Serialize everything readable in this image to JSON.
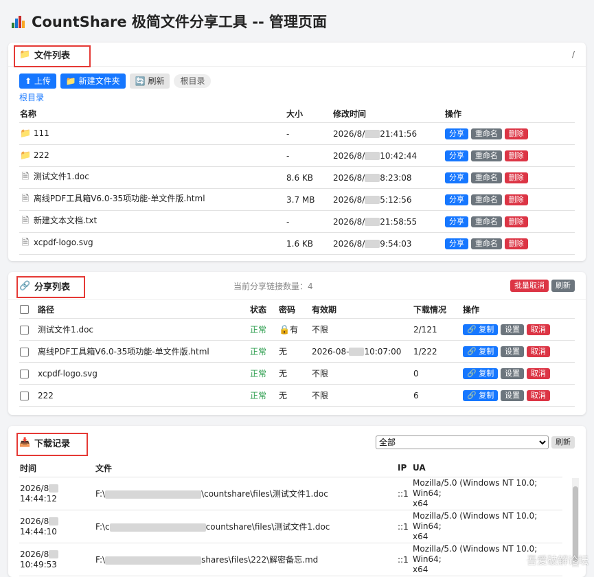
{
  "page": {
    "title": "CountShare 极简文件分享工具 -- 管理页面"
  },
  "files": {
    "title": "文件列表",
    "path_right": "/",
    "buttons": {
      "upload": "上传",
      "new_folder": "新建文件夹",
      "refresh": "刷新"
    },
    "current_dir": "根目录",
    "breadcrumb": "根目录",
    "headers": [
      "名称",
      "大小",
      "修改时间",
      "操作"
    ],
    "rows": [
      {
        "type": "folder",
        "name": "111",
        "size": "-",
        "time_a": "2026/8/",
        "time_b": "21:41:56"
      },
      {
        "type": "folder",
        "name": "222",
        "size": "-",
        "time_a": "2026/8/",
        "time_b": "10:42:44"
      },
      {
        "type": "file",
        "name": "测试文件1.doc",
        "size": "8.6 KB",
        "time_a": "2026/8/",
        "time_b": "8:23:08"
      },
      {
        "type": "file",
        "name": "离线PDF工具箱V6.0-35项功能-单文件版.html",
        "size": "3.7 MB",
        "time_a": "2026/8/",
        "time_b": "5:12:56"
      },
      {
        "type": "file",
        "name": "新建文本文档.txt",
        "size": "-",
        "time_a": "2026/8/",
        "time_b": "21:58:55"
      },
      {
        "type": "file",
        "name": "xcpdf-logo.svg",
        "size": "1.6 KB",
        "time_a": "2026/8/",
        "time_b": "9:54:03"
      }
    ],
    "actions": {
      "share": "分享",
      "rename": "重命名",
      "delete": "删除"
    }
  },
  "shares": {
    "title": "分享列表",
    "count_label": "当前分享链接数量：",
    "count": "4",
    "buttons": {
      "batch_cancel": "批量取消",
      "refresh": "刷新"
    },
    "headers": [
      "路径",
      "状态",
      "密码",
      "有效期",
      "下载情况",
      "操作"
    ],
    "rows": [
      {
        "path": "测试文件1.doc",
        "status": "正常",
        "password": "有",
        "locked": true,
        "expire": "不限",
        "downloads": "2/121"
      },
      {
        "path": "离线PDF工具箱V6.0-35项功能-单文件版.html",
        "status": "正常",
        "password": "无",
        "locked": false,
        "expire": "2026-08-",
        "expire_b": "10:07:00",
        "downloads": "1/222"
      },
      {
        "path": "xcpdf-logo.svg",
        "status": "正常",
        "password": "无",
        "locked": false,
        "expire": "不限",
        "downloads": "0"
      },
      {
        "path": "222",
        "status": "正常",
        "password": "无",
        "locked": false,
        "expire": "不限",
        "downloads": "6"
      }
    ],
    "actions": {
      "copy": "复制",
      "settings": "设置",
      "cancel": "取消"
    }
  },
  "downloads": {
    "title": "下载记录",
    "filter": "全部",
    "refresh": "刷新",
    "headers": [
      "时间",
      "文件",
      "IP",
      "UA"
    ],
    "rows": [
      {
        "date": "2026/8",
        "time": "14:44:12",
        "file_a": "F:\\",
        "file_b": "\\countshare\\files\\测试文件1.doc",
        "ip": "::1",
        "ua1": "Mozilla/5.0 (Windows NT 10.0; Win64;",
        "ua2": "x64"
      },
      {
        "date": "2026/8",
        "time": "14:44:10",
        "file_a": "F:\\c",
        "file_b": "countshare\\files\\测试文件1.doc",
        "ip": "::1",
        "ua1": "Mozilla/5.0 (Windows NT 10.0; Win64;",
        "ua2": "x64"
      },
      {
        "date": "2026/8",
        "time": "10:49:53",
        "file_a": "F:\\",
        "file_b": "shares\\files\\222\\解密备忘.md",
        "ip": "::1",
        "ua1": "Mozilla/5.0 (Windows NT 10.0; Win64;",
        "ua2": "x64"
      }
    ]
  },
  "watermark": "吾爱破解论坛"
}
